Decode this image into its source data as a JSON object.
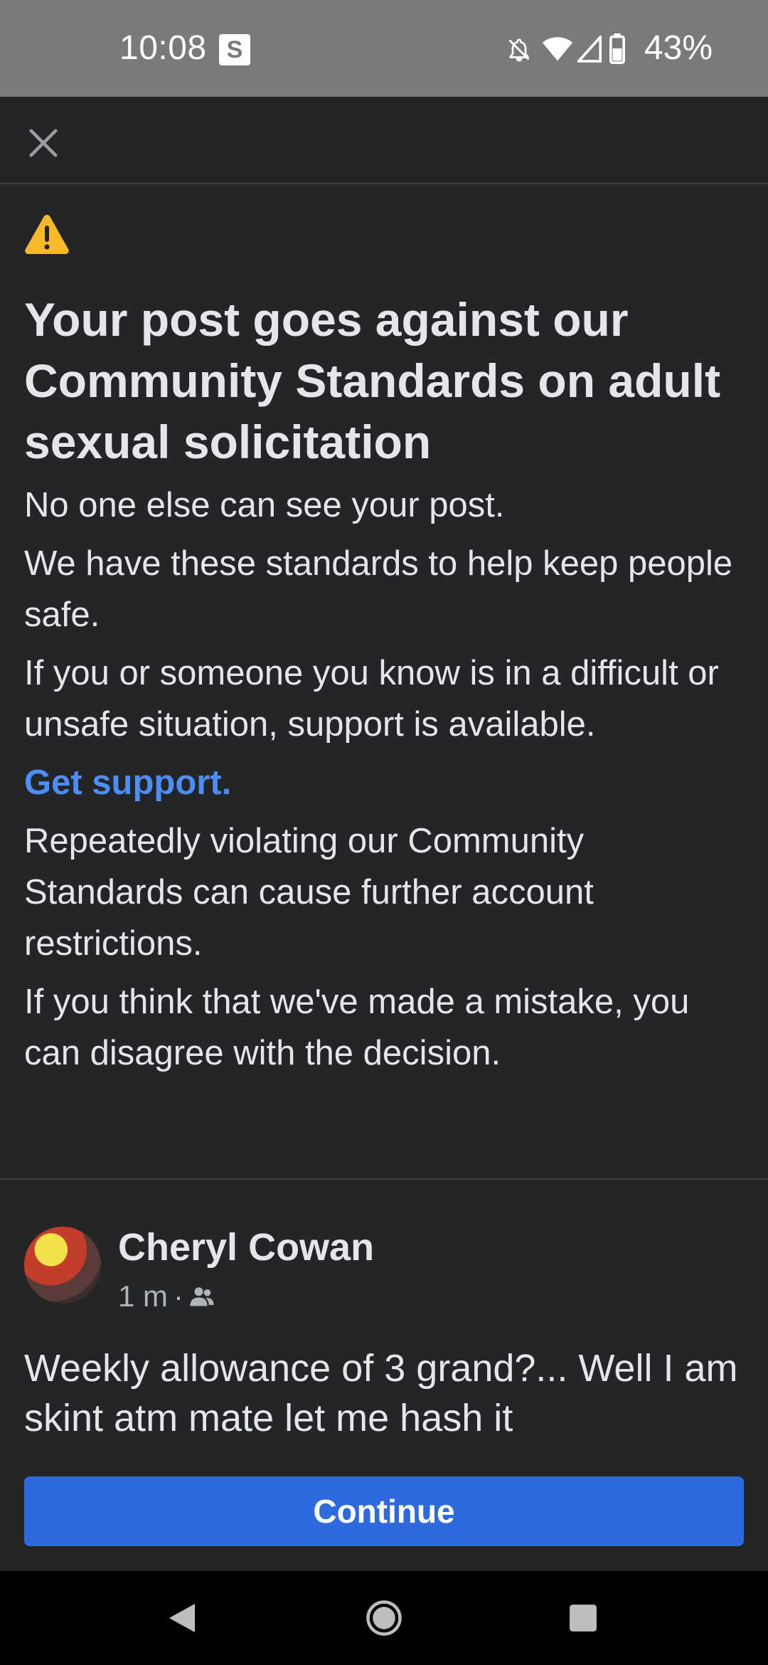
{
  "status_bar": {
    "time": "10:08",
    "badge": "S",
    "battery_percent": "43%",
    "icons": [
      "notifications-off-icon",
      "wifi-icon",
      "cell-signal-icon",
      "battery-icon"
    ]
  },
  "header": {
    "close_icon": "close-icon"
  },
  "notice": {
    "icon": "warning-icon",
    "warning_color": "#f7b928",
    "title": "Your post goes against our Community Standards on adult sexual solicitation",
    "paragraphs": [
      "No one else can see your post.",
      "We have these standards to help keep people safe.",
      "If you or someone you know is in a difficult or unsafe situation, support is available."
    ],
    "support_link": "Get support.",
    "link_color": "#4c8df6",
    "paragraphs_after": [
      "Repeatedly violating our Community Standards can cause further account restrictions.",
      "If you think that we've made a mistake, you can disagree with the decision."
    ]
  },
  "post": {
    "author": "Cheryl Cowan",
    "time": "1 m",
    "separator": "·",
    "audience_icon": "friends-icon",
    "text": "Weekly allowance of 3 grand?... Well I am skint atm mate let me hash it"
  },
  "footer": {
    "continue_label": "Continue",
    "button_color": "#2d6ae0"
  },
  "nav_bar": {
    "icons": [
      "back-icon",
      "home-icon",
      "recents-icon"
    ]
  }
}
